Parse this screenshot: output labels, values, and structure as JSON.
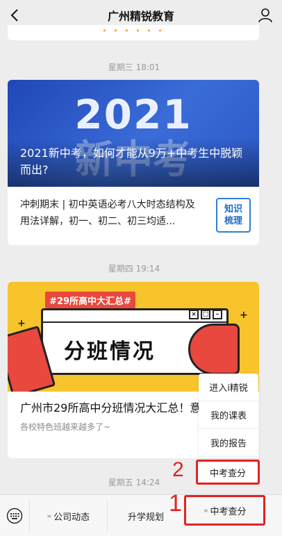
{
  "header": {
    "title": "广州精锐教育"
  },
  "timestamps": [
    "星期三 18:01",
    "星期四 19:14",
    "星期五 14:24"
  ],
  "article1": {
    "banner_year": "2021",
    "banner_subtitle": "新中考",
    "caption": "2021新中考，如何才能从9万+中考生中脱颖而出?",
    "sub_title": "冲刺期末 | 初中英语必考八大时态结构及用法详解，初一、初二、初三均适...",
    "thumb_line1": "知识",
    "thumb_line2": "梳理"
  },
  "article2": {
    "tag": "#29所高中大汇总#",
    "banner_word": "分班情况",
    "caption": "广州市29所高中分班情况大汇总！意的吗?",
    "desc": "各校特色班越来越多了~"
  },
  "popup": {
    "items": [
      "进入i精锐",
      "我的课表",
      "我的报告",
      "中考查分"
    ]
  },
  "annotations": {
    "num1": "1",
    "num2": "2"
  },
  "menu": {
    "items": [
      "公司动态",
      "升学规划",
      "中考查分"
    ]
  }
}
